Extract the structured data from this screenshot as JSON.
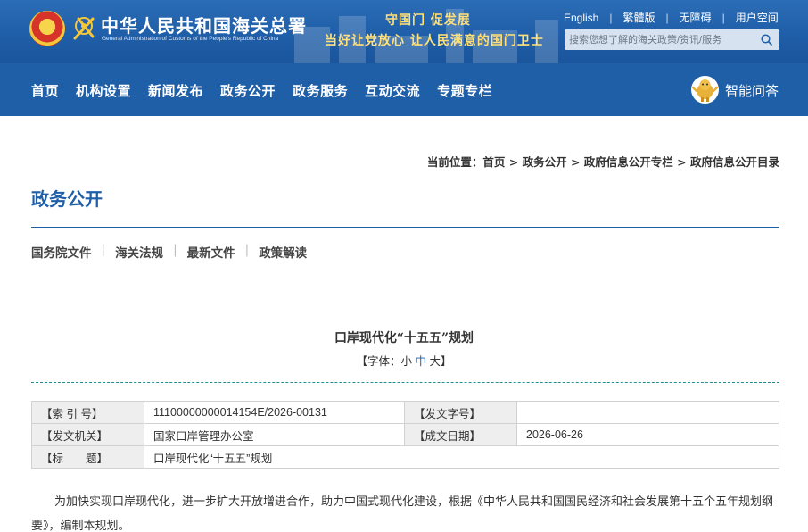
{
  "header": {
    "title": "中华人民共和国海关总署",
    "subtitle": "General Administration of Customs of the People's Republic of China",
    "slogan_line1": "守国门   促发展",
    "slogan_line2": "当好让党放心   让人民满意的国门卫士",
    "links": [
      "English",
      "繁體版",
      "无障碍",
      "用户空间"
    ],
    "search_placeholder": "搜索您想了解的海关政策/资讯/服务"
  },
  "nav": {
    "items": [
      "首页",
      "机构设置",
      "新闻发布",
      "政务公开",
      "政务服务",
      "互动交流",
      "专题专栏"
    ],
    "ai_label": "智能问答"
  },
  "breadcrumb": {
    "prefix": "当前位置：",
    "items": [
      "首页",
      "政务公开",
      "政府信息公开专栏",
      "政府信息公开目录"
    ],
    "separator": " > "
  },
  "section_title": "政务公开",
  "subnav": [
    "国务院文件",
    "海关法规",
    "最新文件",
    "政策解读"
  ],
  "document": {
    "title": "口岸现代化“十五五”规划",
    "fontsize_prefix": "【字体：",
    "fontsize_small": "小",
    "fontsize_medium": "中",
    "fontsize_large": "大",
    "fontsize_suffix": "】",
    "meta": {
      "index_label": "【索 引 号】",
      "index_value": "11100000000014154E/2026-00131",
      "docno_label": "【发文字号】",
      "docno_value": "",
      "issuer_label": "【发文机关】",
      "issuer_value": "国家口岸管理办公室",
      "date_label": "【成文日期】",
      "date_value": "2026-06-26",
      "title_label": "【标　　题】",
      "title_value": "口岸现代化“十五五”规划"
    },
    "paragraph": "为加快实现口岸现代化，进一步扩大开放增进合作，助力中国式现代化建设，根据《中华人民共和国国民经济和社会发展第十五个五年规划纲要》，编制本规划。"
  },
  "colors": {
    "brand_blue": "#1f5fa8",
    "slogan_gold": "#ffe07a",
    "dash_teal": "#1f8f8f"
  }
}
